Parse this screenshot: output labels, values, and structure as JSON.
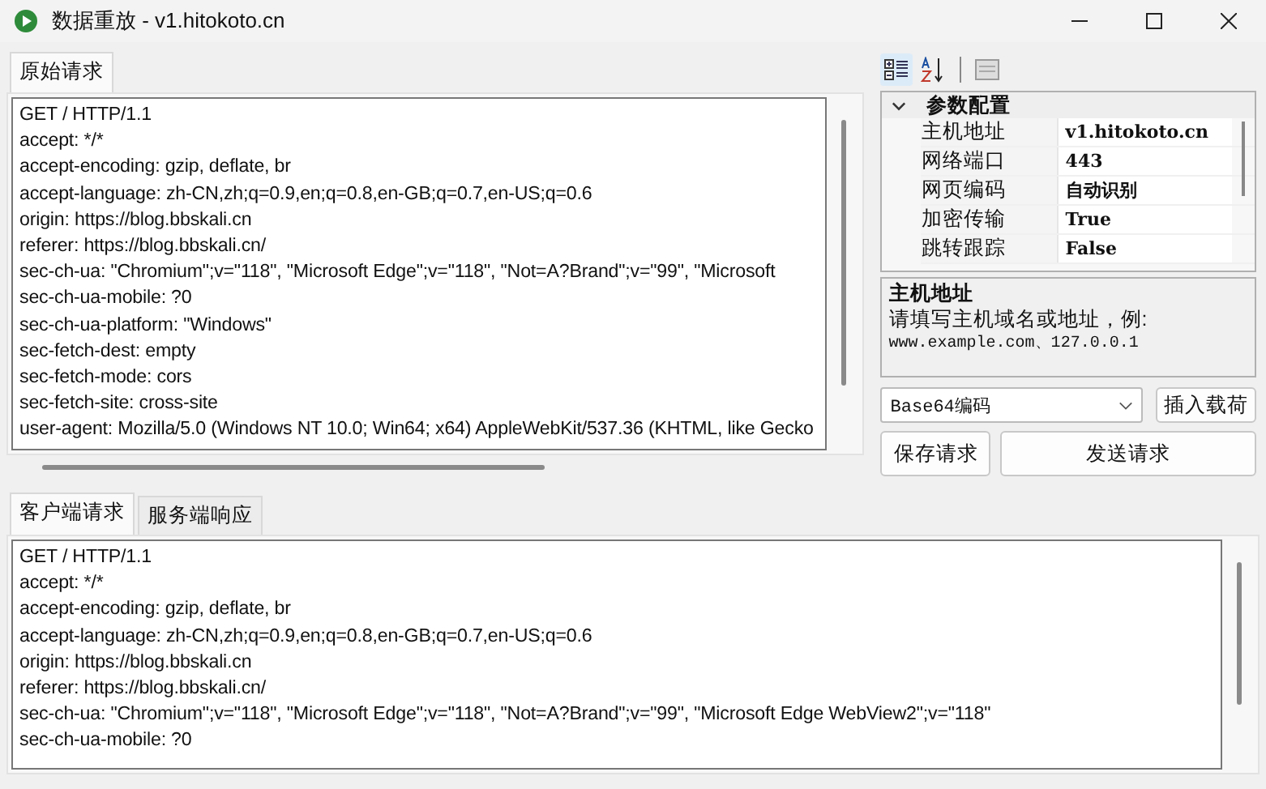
{
  "window": {
    "title": "数据重放 - v1.hitokoto.cn"
  },
  "request_panel": {
    "tabs": [
      {
        "label": "原始请求",
        "selected": true
      }
    ],
    "lines": [
      "GET / HTTP/1.1",
      "accept: */*",
      "accept-encoding: gzip, deflate, br",
      "accept-language: zh-CN,zh;q=0.9,en;q=0.8,en-GB;q=0.7,en-US;q=0.6",
      "origin: https://blog.bbskali.cn",
      "referer: https://blog.bbskali.cn/",
      "sec-ch-ua: \"Chromium\";v=\"118\", \"Microsoft Edge\";v=\"118\", \"Not=A?Brand\";v=\"99\", \"Microsoft",
      "sec-ch-ua-mobile: ?0",
      "sec-ch-ua-platform: \"Windows\"",
      "sec-fetch-dest: empty",
      "sec-fetch-mode: cors",
      "sec-fetch-site: cross-site",
      "user-agent: Mozilla/5.0 (Windows NT 10.0; Win64; x64) AppleWebKit/537.36 (KHTML, like Gecko"
    ]
  },
  "property_toolbar": [
    {
      "kind": "categorized",
      "selected": true
    },
    {
      "kind": "alphabetical",
      "selected": false
    },
    {
      "kind": "pages",
      "selected": false
    }
  ],
  "property_grid": {
    "category": {
      "label": "参数配置",
      "expanded": true
    },
    "rows": [
      {
        "name": "主机地址",
        "value": "v1.hitokoto.cn"
      },
      {
        "name": "网络端口",
        "value": "443"
      },
      {
        "name": "网页编码",
        "value": "自动识别"
      },
      {
        "name": "加密传输",
        "value": "True"
      },
      {
        "name": "跳转跟踪",
        "value": "False"
      }
    ]
  },
  "description": {
    "title": "主机地址",
    "text": "请填写主机域名或地址，例:",
    "example": "www.example.com、127.0.0.1"
  },
  "payload_select": {
    "value": "Base64编码"
  },
  "buttons": {
    "insert": "插入载荷",
    "save": "保存请求",
    "send": "发送请求"
  },
  "exchange_panel": {
    "tabs": [
      {
        "label": "客户端请求",
        "selected": true
      },
      {
        "label": "服务端响应",
        "selected": false
      }
    ],
    "lines": [
      "GET / HTTP/1.1",
      "accept: */*",
      "accept-encoding: gzip, deflate, br",
      "accept-language: zh-CN,zh;q=0.9,en;q=0.8,en-GB;q=0.7,en-US;q=0.6",
      "origin: https://blog.bbskali.cn",
      "referer: https://blog.bbskali.cn/",
      "sec-ch-ua: \"Chromium\";v=\"118\", \"Microsoft Edge\";v=\"118\", \"Not=A?Brand\";v=\"99\", \"Microsoft Edge WebView2\";v=\"118\"",
      "sec-ch-ua-mobile: ?0"
    ]
  }
}
